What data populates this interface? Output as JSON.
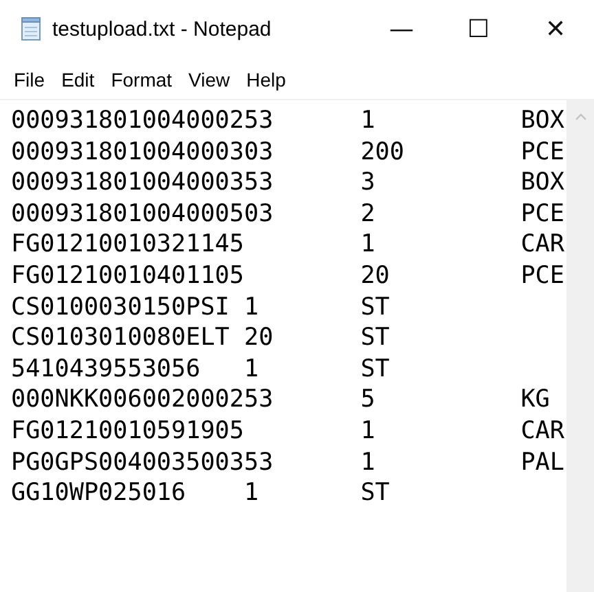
{
  "window": {
    "title": "testupload.txt - Notepad",
    "controls": [
      "—",
      "☐",
      "✕"
    ]
  },
  "menu": [
    {
      "label": "File"
    },
    {
      "label": "Edit"
    },
    {
      "label": "Format"
    },
    {
      "label": "View"
    },
    {
      "label": "Help"
    }
  ],
  "lines": [
    {
      "kind": "three",
      "cells": [
        "000931801004000253",
        "1",
        "BOX"
      ]
    },
    {
      "kind": "three",
      "cells": [
        "000931801004000303",
        "200",
        "PCE"
      ]
    },
    {
      "kind": "three",
      "cells": [
        "000931801004000353",
        "3",
        "BOX"
      ]
    },
    {
      "kind": "three",
      "cells": [
        "000931801004000503",
        "2",
        "PCE"
      ]
    },
    {
      "kind": "three",
      "cells": [
        "FG01210010321145",
        "1",
        "CAR"
      ]
    },
    {
      "kind": "three",
      "cells": [
        "FG01210010401105",
        "20",
        "PCE"
      ]
    },
    {
      "kind": "two",
      "cells": [
        "CS0100030150PSI 1",
        "ST"
      ]
    },
    {
      "kind": "two",
      "cells": [
        "CS0103010080ELT 20",
        "ST"
      ]
    },
    {
      "kind": "two",
      "cells": [
        "5410439553056   1",
        "ST"
      ]
    },
    {
      "kind": "three",
      "cells": [
        "000NKK006002000253",
        "5",
        "KG"
      ]
    },
    {
      "kind": "three",
      "cells": [
        "FG01210010591905",
        "1",
        "CAR"
      ]
    },
    {
      "kind": "three",
      "cells": [
        "PG0GPS004003500353",
        "1",
        "PAL"
      ]
    },
    {
      "kind": "two",
      "cells": [
        "GG10WP025016    1",
        "ST"
      ]
    }
  ]
}
